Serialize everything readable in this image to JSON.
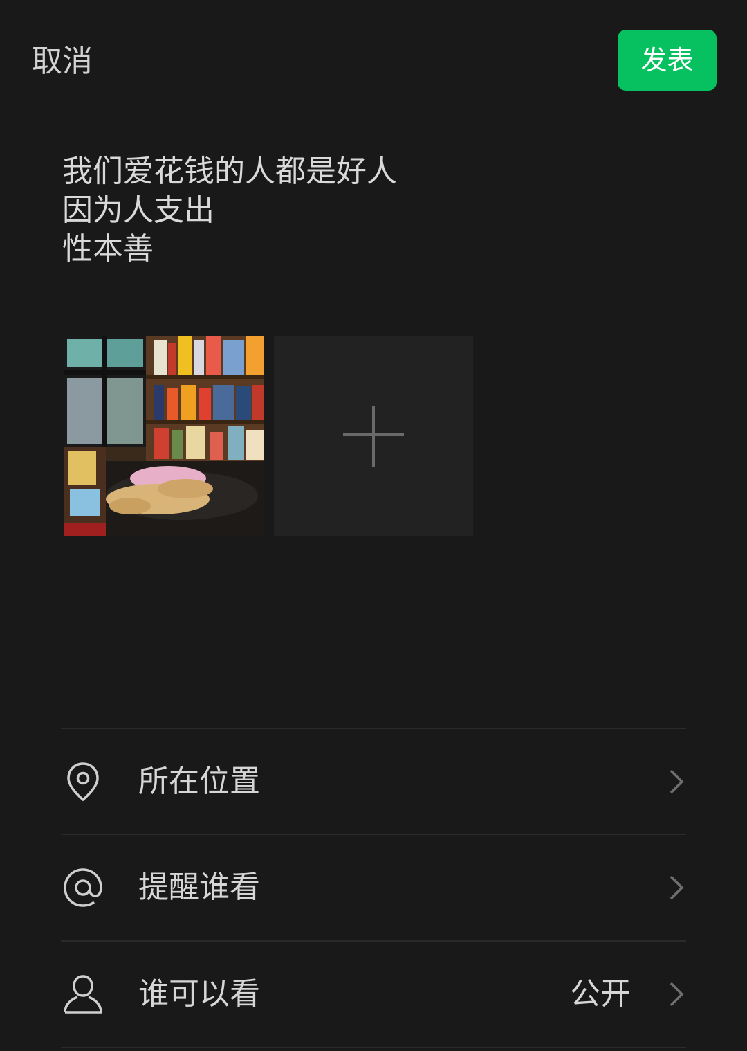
{
  "header": {
    "cancel_label": "取消",
    "publish_label": "发表",
    "publish_color": "#07c160"
  },
  "post": {
    "text": "我们爱花钱的人都是好人\n因为人支出\n性本善"
  },
  "media": {
    "photos": [
      {
        "icon": "bookstore-photo"
      }
    ],
    "add_icon": "plus-icon"
  },
  "options": [
    {
      "icon": "location-pin-icon",
      "label": "所在位置",
      "value": ""
    },
    {
      "icon": "at-sign-icon",
      "label": "提醒谁看",
      "value": ""
    },
    {
      "icon": "person-icon",
      "label": "谁可以看",
      "value": "公开"
    }
  ],
  "colors": {
    "background": "#191919",
    "text": "#d6d6d6",
    "accent": "#07c160"
  }
}
